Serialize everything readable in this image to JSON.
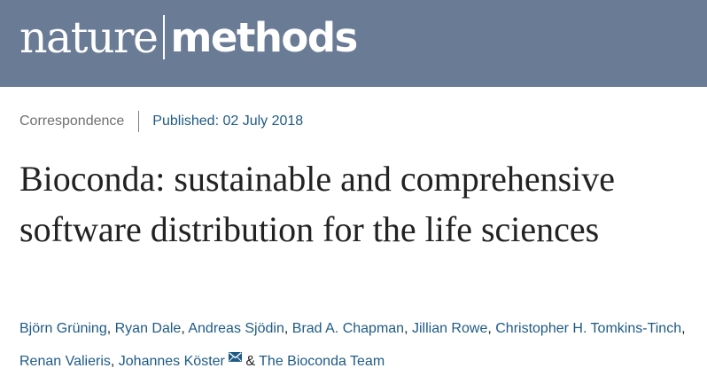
{
  "masthead": {
    "logo_nature": "nature",
    "logo_methods": "methods"
  },
  "article": {
    "type": "Correspondence",
    "published": "Published: 02 July 2018",
    "title": "Bioconda: sustainable and comprehensive software distribution for the life sciences",
    "authors": [
      "Björn Grüning",
      "Ryan Dale",
      "Andreas Sjödin",
      "Brad A. Chapman",
      "Jillian Rowe",
      "Christopher H. Tomkins-Tinch",
      "Renan Valieris",
      "Johannes Köster"
    ],
    "separator": ",",
    "ampersand": "&",
    "team": "The Bioconda Team",
    "corresponding_icon": "mail-icon"
  },
  "colors": {
    "header_bg": "#6a7b95",
    "link": "#1e5a86",
    "text": "#222222",
    "muted": "#6f6f6f"
  }
}
